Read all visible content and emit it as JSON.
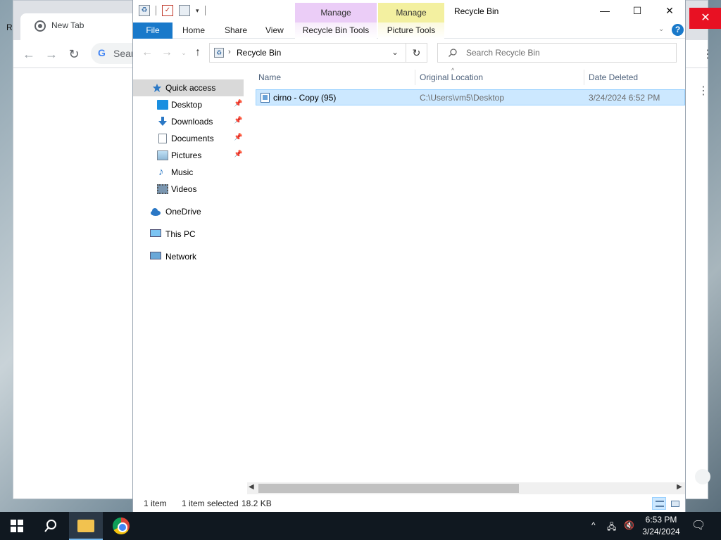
{
  "desktop": {
    "edge_letter": "R"
  },
  "chrome": {
    "tab_title": "New Tab",
    "omnibox_text": "Sear",
    "close_glyph": "✕"
  },
  "explorer": {
    "title": "Recycle Bin",
    "contextual_groups": [
      "Manage",
      "Manage"
    ],
    "ribbon_tabs": {
      "file": "File",
      "home": "Home",
      "share": "Share",
      "view": "View",
      "recycle_bin_tools": "Recycle Bin Tools",
      "picture_tools": "Picture Tools"
    },
    "address": {
      "path": "Recycle Bin"
    },
    "search": {
      "placeholder": "Search Recycle Bin"
    },
    "nav": {
      "quick_access": "Quick access",
      "desktop": "Desktop",
      "downloads": "Downloads",
      "documents": "Documents",
      "pictures": "Pictures",
      "music": "Music",
      "videos": "Videos",
      "onedrive": "OneDrive",
      "this_pc": "This PC",
      "network": "Network"
    },
    "columns": {
      "name": "Name",
      "original_location": "Original Location",
      "date_deleted": "Date Deleted"
    },
    "files": [
      {
        "name": "cirno - Copy (95)",
        "original_location": "C:\\Users\\vm5\\Desktop",
        "date_deleted": "3/24/2024 6:52 PM"
      }
    ],
    "status": {
      "item_count": "1 item",
      "selection": "1 item selected",
      "size": "18.2 KB"
    }
  },
  "taskbar": {
    "clock_time": "6:53 PM",
    "clock_date": "3/24/2024"
  },
  "colors": {
    "file_tab_blue": "#1979ca",
    "selection_blue": "#cce8ff",
    "manage_purple": "#ebcdf7",
    "manage_yellow": "#f3f0a0",
    "chrome_close_red": "#e81123",
    "taskbar": "#101820"
  }
}
